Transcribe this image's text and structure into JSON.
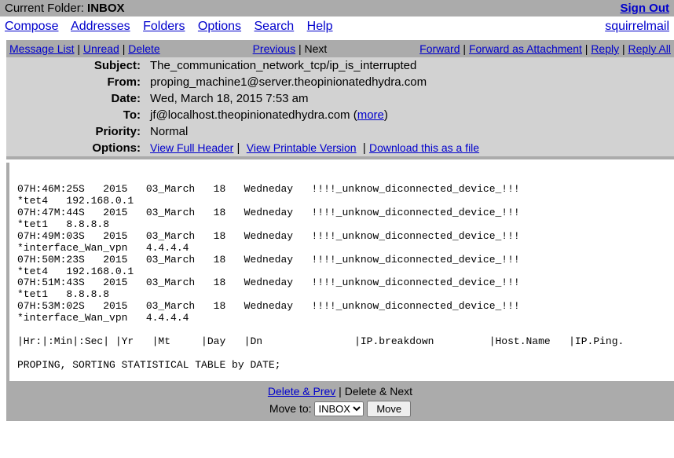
{
  "header": {
    "current_folder_label": "Current Folder: ",
    "current_folder": "INBOX",
    "signout": "Sign Out"
  },
  "nav": {
    "compose": "Compose",
    "addresses": "Addresses",
    "folders": "Folders",
    "options": "Options",
    "search": "Search",
    "help": "Help",
    "brand": "squirrelmail"
  },
  "actions": {
    "message_list": "Message List",
    "unread": "Unread",
    "delete": "Delete",
    "previous": "Previous",
    "next": "Next",
    "forward": "Forward",
    "forward_attachment": "Forward as Attachment",
    "reply": "Reply",
    "reply_all": "Reply All"
  },
  "labels": {
    "subject": "Subject:",
    "from": "From:",
    "date": "Date:",
    "to": "To:",
    "priority": "Priority:",
    "options": "Options:"
  },
  "message": {
    "subject": "The_communication_network_tcp/ip_is_interrupted",
    "from": "proping_machine1@server.theopinionatedhydra.com",
    "date": "Wed, March 18, 2015 7:53 am",
    "to_prefix": "jf@localhost.theopinionatedhydra.com (",
    "to_more": "more",
    "to_suffix": ")",
    "priority": "Normal",
    "view_full_header": "View Full Header",
    "view_printable": "View Printable Version",
    "download_file": "Download this as a file"
  },
  "body": "\n07H:46M:25S   2015   03_March   18   Wedneday   !!!!_unknow_diconnected_device_!!!\n*tet4   192.168.0.1\n07H:47M:44S   2015   03_March   18   Wedneday   !!!!_unknow_diconnected_device_!!!\n*tet1   8.8.8.8\n07H:49M:03S   2015   03_March   18   Wedneday   !!!!_unknow_diconnected_device_!!!\n*interface_Wan_vpn   4.4.4.4\n07H:50M:23S   2015   03_March   18   Wedneday   !!!!_unknow_diconnected_device_!!!\n*tet4   192.168.0.1\n07H:51M:43S   2015   03_March   18   Wedneday   !!!!_unknow_diconnected_device_!!!\n*tet1   8.8.8.8\n07H:53M:02S   2015   03_March   18   Wedneday   !!!!_unknow_diconnected_device_!!!\n*interface_Wan_vpn   4.4.4.4\n\n|Hr:|:Min|:Sec| |Yr   |Mt     |Day   |Dn               |IP.breakdown         |Host.Name   |IP.Ping.\n\nPROPING, SORTING STATISTICAL TABLE by DATE;\n",
  "footer": {
    "delete_prev": "Delete & Prev",
    "delete_next": "Delete & Next",
    "move_to_label": "Move to:",
    "move_button": "Move",
    "select_value": "INBOX"
  }
}
